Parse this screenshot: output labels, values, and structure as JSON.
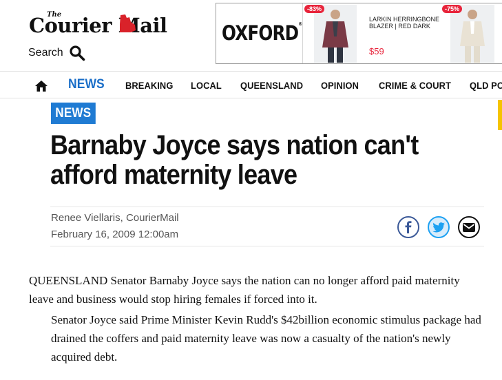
{
  "masthead": {
    "logo_the": "The",
    "logo_text": "Courier Mail",
    "search_label": "Search"
  },
  "ad": {
    "brand": "OXFORD",
    "badge_1": "-83%",
    "badge_2": "-75%",
    "product_title": "LARKIN HERRINGBONE BLAZER | RED DARK",
    "product_price": "$59"
  },
  "nav": {
    "items": [
      "NEWS",
      "BREAKING",
      "LOCAL",
      "QUEENSLAND",
      "OPINION",
      "CRIME & COURT",
      "QLD PO"
    ],
    "active": "NEWS"
  },
  "article": {
    "section_badge": "NEWS",
    "headline": "Barnaby Joyce says nation can't afford maternity leave",
    "byline": "Renee Viellaris, CourierMail",
    "date": "February 16, 2009 12:00am",
    "paragraphs": [
      "QUEENSLAND Senator Barnaby Joyce says the nation can no longer afford paid maternity leave and business would stop hiring females if forced into it.",
      "Senator Joyce said Prime Minister Kevin Rudd's $42billion economic stimulus package had drained the coffers and paid maternity leave was now a casualty of the nation's newly acquired debt."
    ]
  },
  "share": {
    "icons": [
      "facebook-icon",
      "twitter-icon",
      "email-icon"
    ]
  },
  "colors": {
    "accent_blue": "#1f7bd3",
    "nav_active": "#1a6ec8",
    "logo_red": "#d9222a",
    "ad_badge": "#e8243b"
  }
}
